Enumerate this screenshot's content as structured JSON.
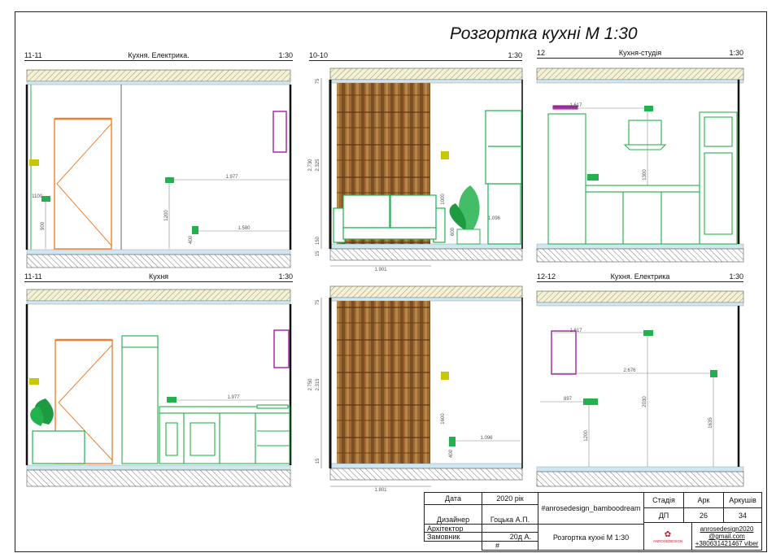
{
  "sheet_title": "Розгортка кухні М 1:30",
  "panels": [
    {
      "id": "11-11",
      "name": "Кухня. Електрика.",
      "scale": "1:30"
    },
    {
      "id": "10-10",
      "name": "",
      "scale": "1:30"
    },
    {
      "id": "12",
      "name": "Кухня-студія",
      "scale": "1:30"
    },
    {
      "id": "11-11",
      "name": "Кухня",
      "scale": "1:30"
    },
    {
      "id": "12-12",
      "name": "Кухня. Електрика",
      "scale": "1:30"
    }
  ],
  "dimensions": {
    "p1": [
      "1.977",
      "1.580",
      "1200",
      "400",
      "900",
      "1100"
    ],
    "p2": [
      "2.730",
      "2.325",
      "1.901",
      "1000",
      "600",
      "150",
      "75",
      "1.096",
      "15"
    ],
    "p3": [
      "1.617",
      "1300"
    ],
    "p4": [
      "1.977"
    ],
    "p5": [
      "2.750",
      "2.315",
      "1.801",
      "1.096",
      "1600",
      "400",
      "15",
      "75"
    ],
    "p6": [
      "1.617",
      "2.676",
      "897",
      "2030",
      "1635",
      "1200"
    ]
  },
  "title_block": {
    "date_label": "Дата",
    "date_value": "2020 рік",
    "hashtag": "#anrosedesign_bamboodream",
    "stage_label": "Стадія",
    "sheet_label": "Арк",
    "sheets_label": "Аркушів",
    "designer_label": "Дизайнер",
    "designer_value": "Гоцька А.П.",
    "architect_label": "Архітектор",
    "client_label": "Замовник",
    "client_value": "20д А.",
    "hash_mark": "#",
    "drawing_name": "Розгортка кухні М 1:30",
    "stage_value": "ДП",
    "sheet_value": "26",
    "sheets_value": "34",
    "logo_text": "ANROSEDESIGN",
    "contact_site": "anrosedesign2020",
    "contact_mail": "@gmail.com",
    "contact_phone": "+380631421467 viber"
  },
  "colors": {
    "fixture": "#22b14c",
    "door": "#f08030",
    "accent": "#a020a0",
    "socket": "#c8c800",
    "bamboo": "#8b5a2b",
    "hatch": "#c9c27a"
  }
}
